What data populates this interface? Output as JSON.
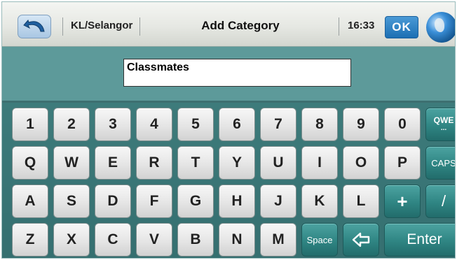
{
  "header": {
    "region": "KL/Selangor",
    "title": "Add Category",
    "time": "16:33",
    "ok_label": "OK"
  },
  "input": {
    "value": "Classmates"
  },
  "keyboard": {
    "row1": [
      "1",
      "2",
      "3",
      "4",
      "5",
      "6",
      "7",
      "8",
      "9",
      "0"
    ],
    "row2": [
      "Q",
      "W",
      "E",
      "R",
      "T",
      "Y",
      "U",
      "I",
      "O",
      "P"
    ],
    "row3": [
      "A",
      "S",
      "D",
      "F",
      "G",
      "H",
      "J",
      "K",
      "L"
    ],
    "row4": [
      "Z",
      "X",
      "C",
      "V",
      "B",
      "N",
      "M"
    ],
    "layout_label": "QWE",
    "layout_dots": "...",
    "caps_label": "CAPS",
    "plus_label": "+",
    "slash_label": "/",
    "space_label": "Space",
    "enter_label": "Enter"
  },
  "icons": {
    "back": "back-arrow-icon",
    "globe": "globe-icon",
    "backspace": "backspace-icon"
  },
  "colors": {
    "teal_panel": "#5d9a9a",
    "keyboard_bg": "#3d7b7b",
    "ok_blue": "#1c6fb3"
  }
}
